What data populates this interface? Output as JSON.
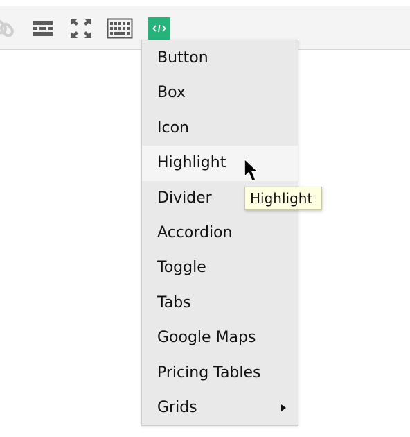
{
  "toolbar": {
    "buttons": [
      {
        "icon": "link-icon",
        "active": false
      },
      {
        "icon": "horizontal-rule-icon",
        "active": false
      },
      {
        "icon": "fullscreen-icon",
        "active": false
      },
      {
        "icon": "keyboard-icon",
        "active": false
      },
      {
        "icon": "code-shortcode-icon",
        "active": true
      }
    ],
    "active_color": "#26b37b"
  },
  "menu": {
    "items": [
      {
        "label": "Button"
      },
      {
        "label": "Box"
      },
      {
        "label": "Icon"
      },
      {
        "label": "Highlight",
        "hovered": true
      },
      {
        "label": "Divider"
      },
      {
        "label": "Accordion"
      },
      {
        "label": "Toggle"
      },
      {
        "label": "Tabs"
      },
      {
        "label": "Google Maps"
      },
      {
        "label": "Pricing Tables"
      },
      {
        "label": "Grids",
        "has_submenu": true
      }
    ]
  },
  "tooltip": {
    "text": "Highlight"
  },
  "cursor": {
    "icon": "arrow-cursor-icon"
  }
}
